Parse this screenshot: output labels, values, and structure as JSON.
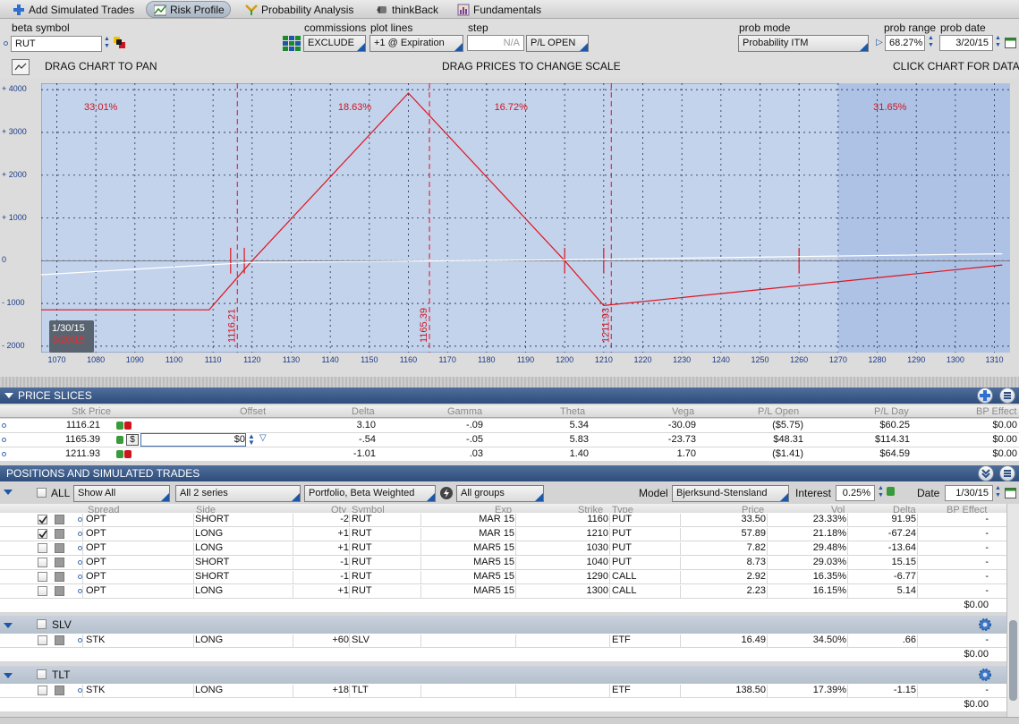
{
  "toolbar": {
    "items": [
      {
        "label": "Add Simulated Trades",
        "icon": "plus-icon"
      },
      {
        "label": "Risk Profile",
        "icon": "chart-icon",
        "active": true
      },
      {
        "label": "Probability Analysis",
        "icon": "probability-icon"
      },
      {
        "label": "thinkBack",
        "icon": "thinkback-icon"
      },
      {
        "label": "Fundamentals",
        "icon": "fundamentals-icon"
      }
    ]
  },
  "controls": {
    "beta_symbol_label": "beta symbol",
    "beta_symbol_value": "RUT",
    "commissions_label": "commissions",
    "commissions_value": "EXCLUDE",
    "plot_lines_label": "plot lines",
    "plot_lines_value": "+1 @ Expiration",
    "step_label": "step",
    "step_value": "N/A",
    "pl_mode_value": "P/L OPEN",
    "prob_mode_label": "prob mode",
    "prob_mode_value": "Probability ITM",
    "prob_range_label": "prob range",
    "prob_range_value": "68.27%",
    "prob_date_label": "prob date",
    "prob_date_value": "3/20/15",
    "drag_pan": "DRAG CHART TO PAN",
    "drag_prices": "DRAG PRICES TO CHANGE SCALE",
    "click_chart": "CLICK CHART FOR DATA"
  },
  "chart_data": {
    "type": "line",
    "x_ticks": [
      1070,
      1080,
      1090,
      1100,
      1110,
      1120,
      1130,
      1140,
      1150,
      1160,
      1170,
      1180,
      1190,
      1200,
      1210,
      1220,
      1230,
      1240,
      1250,
      1260,
      1270,
      1280,
      1290,
      1300,
      1310
    ],
    "y_ticks": [
      "+ 4000",
      "+ 3000",
      "+ 2000",
      "+ 1000",
      "0",
      "- 1000",
      "- 2000"
    ],
    "y_tick_values": [
      4000,
      3000,
      2000,
      1000,
      0,
      -1000,
      -2000
    ],
    "xlim": [
      1066,
      1314
    ],
    "ylim": [
      -2150,
      4150
    ],
    "series": [
      {
        "color": "#e0141e",
        "x": [
          1066,
          1109,
          1120,
          1160,
          1200,
          1210,
          1312
        ],
        "y": [
          -1150,
          -1150,
          0,
          3920,
          0,
          -1050,
          -100
        ]
      },
      {
        "color": "#ffffff",
        "x": [
          1066,
          1120,
          1200,
          1312
        ],
        "y": [
          -330,
          -40,
          20,
          160
        ]
      }
    ],
    "prob_regions": [
      "33.01%",
      "18.63%",
      "16.72%",
      "31.65%"
    ],
    "prob_region_x": [
      1077,
      1142,
      1182,
      1279
    ],
    "price_slice_labels": [
      "1116.21",
      "1165.39",
      "1211.93"
    ],
    "price_slice_x": [
      1116.21,
      1165.39,
      1211.93
    ],
    "dates": [
      "1/30/15",
      "3/20/15"
    ],
    "shaded_from_x": 1270,
    "grid": true
  },
  "price_slices": {
    "title": "PRICE SLICES",
    "columns": [
      "Stk Price",
      "Offset",
      "Delta",
      "Gamma",
      "Theta",
      "Vega",
      "P/L Open",
      "P/L Day",
      "BP Effect"
    ],
    "rows": [
      {
        "price": "1116.21",
        "offset": "",
        "delta": "3.10",
        "gamma": "-.09",
        "theta": "5.34",
        "vega": "-30.09",
        "pl_open": "($5.75)",
        "pl_day": "$60.25",
        "bp": "$0.00"
      },
      {
        "price": "1165.39",
        "offset": "$0",
        "delta": "-.54",
        "gamma": "-.05",
        "theta": "5.83",
        "vega": "-23.73",
        "pl_open": "$48.31",
        "pl_day": "$114.31",
        "bp": "$0.00"
      },
      {
        "price": "1211.93",
        "offset": "",
        "delta": "-1.01",
        "gamma": ".03",
        "theta": "1.40",
        "vega": "1.70",
        "pl_open": "($1.41)",
        "pl_day": "$64.59",
        "bp": "$0.00"
      }
    ]
  },
  "positions": {
    "title": "POSITIONS AND SIMULATED TRADES",
    "all_label": "ALL",
    "show_value": "Show All",
    "series_value": "All 2 series",
    "portfolio_value": "Portfolio, Beta Weighted",
    "groups_value": "All groups",
    "model_label": "Model",
    "model_value": "Bjerksund-Stensland",
    "interest_label": "Interest",
    "interest_value": "0.25%",
    "date_label": "Date",
    "date_value": "1/30/15",
    "columns": [
      "Spread",
      "Side",
      "Qty",
      "Symbol",
      "Exp",
      "Strike",
      "Type",
      "Price",
      "Vol",
      "Delta",
      "BP Effect"
    ],
    "rows": [
      {
        "spread": "OPT",
        "side": "SHORT",
        "qty": "-2",
        "symbol": "RUT",
        "exp": "MAR 15",
        "strike": "1160",
        "type": "PUT",
        "price": "33.50",
        "vol": "23.33%",
        "delta": "91.95",
        "bp": "-",
        "checked": true
      },
      {
        "spread": "OPT",
        "side": "LONG",
        "qty": "+1",
        "symbol": "RUT",
        "exp": "MAR 15",
        "strike": "1210",
        "type": "PUT",
        "price": "57.89",
        "vol": "21.18%",
        "delta": "-67.24",
        "bp": "-",
        "checked": true
      },
      {
        "spread": "OPT",
        "side": "LONG",
        "qty": "+1",
        "symbol": "RUT",
        "exp": "MAR5 15",
        "strike": "1030",
        "type": "PUT",
        "price": "7.82",
        "vol": "29.48%",
        "delta": "-13.64",
        "bp": "-",
        "checked": false
      },
      {
        "spread": "OPT",
        "side": "SHORT",
        "qty": "-1",
        "symbol": "RUT",
        "exp": "MAR5 15",
        "strike": "1040",
        "type": "PUT",
        "price": "8.73",
        "vol": "29.03%",
        "delta": "15.15",
        "bp": "-",
        "checked": false
      },
      {
        "spread": "OPT",
        "side": "SHORT",
        "qty": "-1",
        "symbol": "RUT",
        "exp": "MAR5 15",
        "strike": "1290",
        "type": "CALL",
        "price": "2.92",
        "vol": "16.35%",
        "delta": "-6.77",
        "bp": "-",
        "checked": false
      },
      {
        "spread": "OPT",
        "side": "LONG",
        "qty": "+1",
        "symbol": "RUT",
        "exp": "MAR5 15",
        "strike": "1300",
        "type": "CALL",
        "price": "2.23",
        "vol": "16.15%",
        "delta": "5.14",
        "bp": "-",
        "checked": false
      }
    ],
    "rut_total": "$0.00",
    "groups": [
      {
        "name": "SLV",
        "row": {
          "spread": "STK",
          "side": "LONG",
          "qty": "+60",
          "symbol": "SLV",
          "type": "ETF",
          "price": "16.49",
          "vol": "34.50%",
          "delta": ".66",
          "bp": "-"
        },
        "total": "$0.00"
      },
      {
        "name": "TLT",
        "row": {
          "spread": "STK",
          "side": "LONG",
          "qty": "+18",
          "symbol": "TLT",
          "type": "ETF",
          "price": "138.50",
          "vol": "17.39%",
          "delta": "-1.15",
          "bp": "-"
        },
        "total": "$0.00"
      }
    ]
  }
}
